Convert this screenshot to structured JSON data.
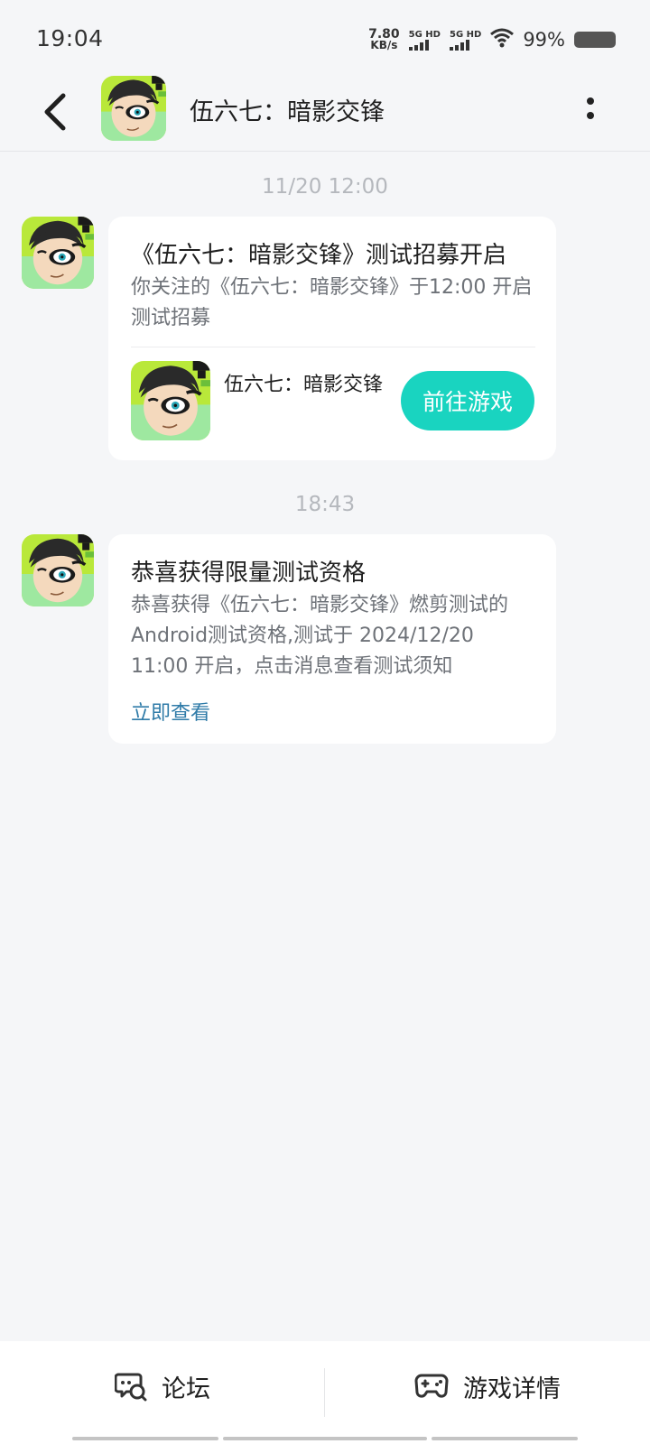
{
  "status_bar": {
    "time": "19:04",
    "net_speed_value": "7.80",
    "net_speed_unit": "KB/s",
    "sim1_label": "5G HD",
    "sim2_label": "5G HD",
    "battery": "99%"
  },
  "header": {
    "title": "伍六七：暗影交锋"
  },
  "messages": [
    {
      "timestamp": "11/20  12:00",
      "title": "《伍六七：暗影交锋》测试招募开启",
      "body": "你关注的《伍六七：暗影交锋》于12:00 开启测试招募",
      "game_name": "伍六七：暗影交锋",
      "button_label": "前往游戏"
    },
    {
      "timestamp": "18:43",
      "title": "恭喜获得限量测试资格",
      "body": "恭喜获得《伍六七：暗影交锋》燃剪测试的Android测试资格,测试于 2024/12/20 11:00 开启，点击消息查看测试须知",
      "link_label": "立即查看"
    }
  ],
  "bottom_tabs": [
    {
      "label": "论坛",
      "icon": "forum-chat-icon"
    },
    {
      "label": "游戏详情",
      "icon": "gamepad-icon"
    }
  ],
  "colors": {
    "accent": "#19d4c0",
    "link": "#2f7ba8",
    "background": "#f5f6f8"
  }
}
